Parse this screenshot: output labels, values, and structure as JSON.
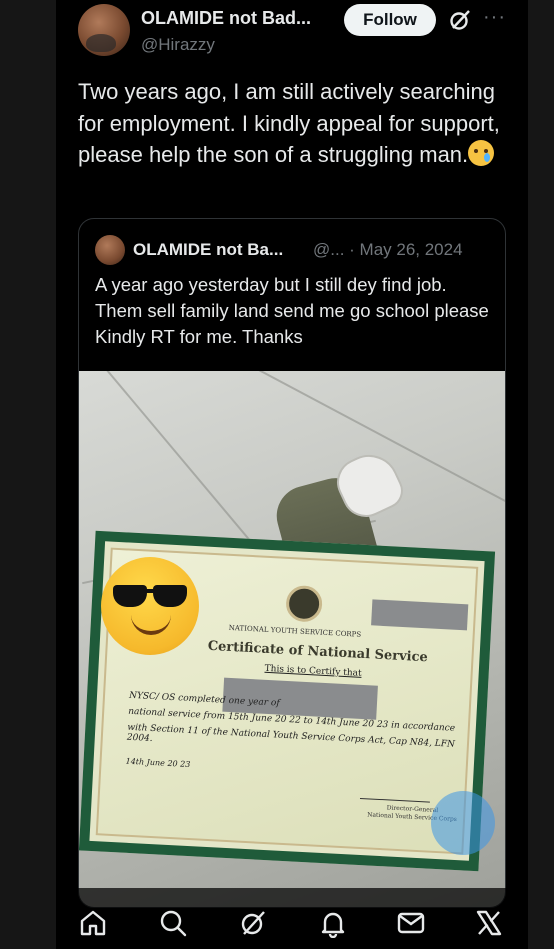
{
  "tweet": {
    "author_name": "OLAMIDE not Bad...",
    "author_handle": "@Hirazzy",
    "follow_label": "Follow",
    "more_label": "···",
    "text": "Two years ago, I am still actively searching for employment. I kindly appeal for support, please help the son of a struggling man.",
    "emoji": "crying-face"
  },
  "quote": {
    "author_name": "OLAMIDE not Ba...",
    "author_handle": "@... · May 26, 2024",
    "text": "A year ago yesterday but I still dey find job. Them sell family land send me go school please Kindly RT for me. Thanks"
  },
  "certificate": {
    "corps_label": "NATIONAL YOUTH SERVICE CORPS",
    "title": "Certificate of National Service",
    "subtitle": "This is to Certify that",
    "line1": "NYSC/      OS         completed one year of",
    "line2": "national service from  15th June  20 22 to 14th June 20 23 in accordance",
    "line3": "with Section 11 of the National Youth Service Corps Act, Cap N84, LFN 2004.",
    "date_line": "14th June 20 23",
    "signatory_title": "Director-General",
    "signatory_org": "National Youth Service Corps"
  },
  "bottom_nav": {
    "items": [
      "home-icon",
      "search-icon",
      "grok-icon",
      "notifications-icon",
      "messages-icon",
      "x-logo-icon"
    ]
  },
  "colors": {
    "background": "#000000",
    "text_primary": "#e7e9ea",
    "text_secondary": "#71767b",
    "follow_button_bg": "#eff3f4"
  }
}
